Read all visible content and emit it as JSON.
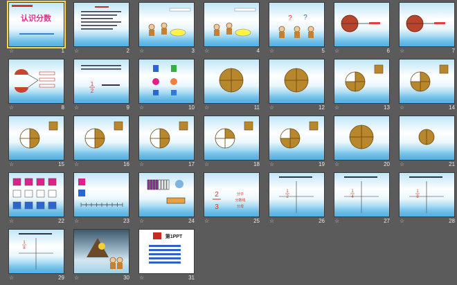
{
  "slides": [
    {
      "n": "1",
      "kind": "title",
      "title": "认识分数"
    },
    {
      "n": "2",
      "kind": "text"
    },
    {
      "n": "3",
      "kind": "characters"
    },
    {
      "n": "4",
      "kind": "characters"
    },
    {
      "n": "5",
      "kind": "question"
    },
    {
      "n": "6",
      "kind": "apple_cut"
    },
    {
      "n": "7",
      "kind": "apple_cut"
    },
    {
      "n": "8",
      "kind": "apple_halves"
    },
    {
      "n": "9",
      "kind": "fraction_text",
      "fraction": {
        "num": "1",
        "den": "2"
      }
    },
    {
      "n": "10",
      "kind": "shapes"
    },
    {
      "n": "11",
      "kind": "circle",
      "parts": 4,
      "shaded": 4
    },
    {
      "n": "12",
      "kind": "circle",
      "parts": 4,
      "shaded": 4
    },
    {
      "n": "13",
      "kind": "circle_split",
      "parts": 4,
      "shaded": 3
    },
    {
      "n": "14",
      "kind": "circle_split",
      "parts": 4,
      "shaded": 3
    },
    {
      "n": "15",
      "kind": "circle_split",
      "parts": 4,
      "shaded": 2
    },
    {
      "n": "16",
      "kind": "circle_split",
      "parts": 4,
      "shaded": 2
    },
    {
      "n": "17",
      "kind": "circle_split",
      "parts": 4,
      "shaded": 2
    },
    {
      "n": "18",
      "kind": "circle_split",
      "parts": 4,
      "shaded": 1
    },
    {
      "n": "19",
      "kind": "circle_split",
      "parts": 4,
      "shaded": 3
    },
    {
      "n": "20",
      "kind": "circle",
      "parts": 4,
      "shaded": 4
    },
    {
      "n": "21",
      "kind": "circle_small",
      "parts": 2,
      "shaded": 2
    },
    {
      "n": "22",
      "kind": "shapes_grid"
    },
    {
      "n": "23",
      "kind": "number_line"
    },
    {
      "n": "24",
      "kind": "bars"
    },
    {
      "n": "25",
      "kind": "fraction_parts",
      "fraction": {
        "num": "2",
        "den": "3"
      },
      "labels": [
        "分子",
        "分数线",
        "分母"
      ]
    },
    {
      "n": "26",
      "kind": "quad",
      "fraction": {
        "num": "1",
        "den": "2"
      }
    },
    {
      "n": "27",
      "kind": "quad",
      "fraction": {
        "num": "1",
        "den": "4"
      }
    },
    {
      "n": "28",
      "kind": "quad",
      "fraction": {
        "num": "1",
        "den": "8"
      }
    },
    {
      "n": "29",
      "kind": "quad_small",
      "fraction": {
        "num": "1",
        "den": "8"
      }
    },
    {
      "n": "30",
      "kind": "scene"
    },
    {
      "n": "31",
      "kind": "ad",
      "title": "第1PPT"
    }
  ],
  "selected": "1",
  "colors": {
    "shade": "#b8862b",
    "accent_red": "#d9321f",
    "blue": "#2a66d1",
    "magenta": "#e0208a"
  }
}
